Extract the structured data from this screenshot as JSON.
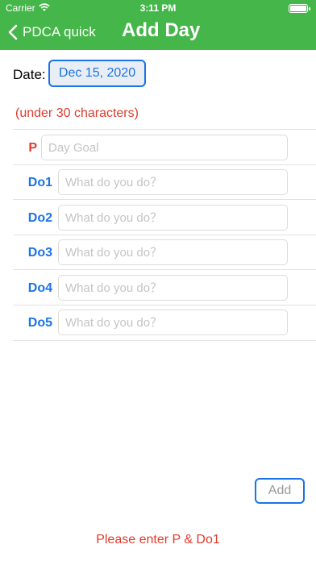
{
  "status_bar": {
    "carrier": "Carrier",
    "time": "3:11 PM"
  },
  "nav": {
    "back_label": "PDCA quick",
    "title": "Add Day"
  },
  "date": {
    "label": "Date:",
    "value": "Dec 15, 2020"
  },
  "hint": "(under 30 characters)",
  "rows": [
    {
      "label": "P",
      "placeholder": "Day Goal",
      "value": ""
    },
    {
      "label": "Do1",
      "placeholder": "What do you do？",
      "value": ""
    },
    {
      "label": "Do2",
      "placeholder": "What do you do？",
      "value": ""
    },
    {
      "label": "Do3",
      "placeholder": "What do you do？",
      "value": ""
    },
    {
      "label": "Do4",
      "placeholder": "What do you do？",
      "value": ""
    },
    {
      "label": "Do5",
      "placeholder": "What do you do？",
      "value": ""
    }
  ],
  "add_button_label": "Add",
  "error_message": "Please enter P & Do1",
  "colors": {
    "nav_green": "#45b649",
    "accent_blue": "#1a73e8",
    "error_red": "#e03a2c"
  },
  "icons": {
    "back": "chevron-left-icon",
    "wifi": "wifi-icon",
    "battery": "battery-icon"
  }
}
